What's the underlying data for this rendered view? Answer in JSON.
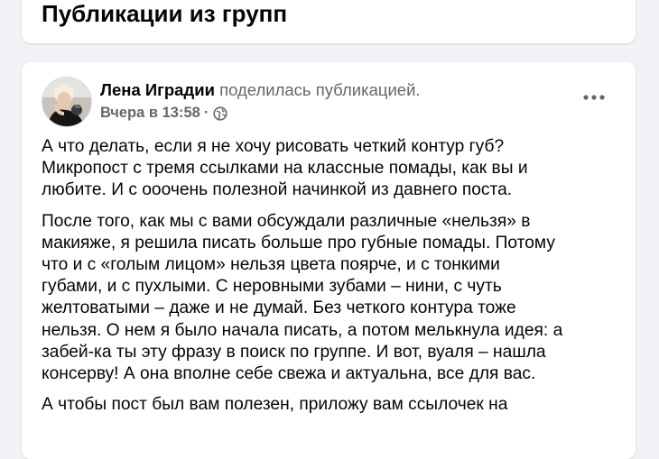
{
  "section": {
    "title": "Публикации из групп"
  },
  "post": {
    "author": "Лена Иградии",
    "author_display": "Лена Иградии",
    "shared": "поделилась публикацией.",
    "time": "Вчера в 13:58",
    "separator": "·",
    "visibility_icon": "globe-icon",
    "more_icon": "more-dots-icon",
    "paragraphs": [
      "А что делать, если я не хочу рисовать четкий контур губ?\nМикропост с тремя ссылками на классные помады, как вы и\nлюбите. И с ооочень полезной начинкой из давнего поста.",
      "После того, как мы с вами обсуждали различные «нельзя» в\nмакияже, я решила писать больше про губные помады. Потому\nчто и с «голым лицом» нельзя цвета поярче, и с тонкими\nгубами, и с пухлыми. С неровными зубами – нини, с чуть\nжелтоватыми – даже и не думай. Без четкого контура тоже\nнельзя. О нем я было начала писать, а потом мелькнула идея: а\nзабей-ка ты эту фразу в поиск по группе. И вот, вуаля – нашла\nконсерву! А она вполне себе свежа и актуальна, все для вас.",
      "А чтобы пост был вам полезен, приложу вам ссылочек на"
    ]
  },
  "colors": {
    "background": "#f0f2f5",
    "card": "#ffffff",
    "primary_text": "#050505",
    "secondary_text": "#65676b"
  }
}
